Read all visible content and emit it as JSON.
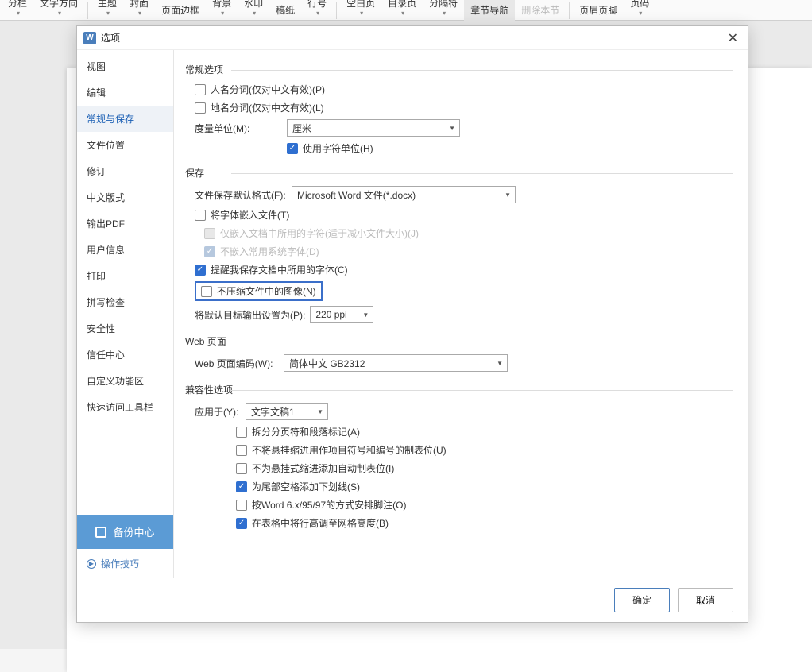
{
  "ribbon": {
    "items": [
      {
        "label": "分栏",
        "dd": true
      },
      {
        "label": "文字方向",
        "dd": true
      },
      {
        "sep": true
      },
      {
        "label": "主题",
        "dd": true
      },
      {
        "label": "封面",
        "dd": true
      },
      {
        "label": "页面边框"
      },
      {
        "label": "背景",
        "dd": true
      },
      {
        "label": "水印",
        "dd": true
      },
      {
        "label": "稿纸"
      },
      {
        "label": "行号",
        "dd": true
      },
      {
        "sep": true
      },
      {
        "label": "空白页",
        "dd": true
      },
      {
        "label": "目录页",
        "dd": true
      },
      {
        "label": "分隔符",
        "dd": true
      },
      {
        "label": "章节导航",
        "active": true
      },
      {
        "label": "删除本节",
        "disabled": true
      },
      {
        "sep": true
      },
      {
        "label": "页眉页脚"
      },
      {
        "label": "页码",
        "dd": true
      }
    ]
  },
  "dialog": {
    "title": "选项",
    "sidebar": [
      "视图",
      "编辑",
      "常规与保存",
      "文件位置",
      "修订",
      "中文版式",
      "输出PDF",
      "用户信息",
      "打印",
      "拼写检查",
      "安全性",
      "信任中心",
      "自定义功能区",
      "快速访问工具栏"
    ],
    "selectedIndex": 2,
    "backup": "备份中心",
    "tips": "操作技巧",
    "groups": {
      "general": {
        "title": "常规选项",
        "personName": "人名分词(仅对中文有效)(P)",
        "placeName": "地名分词(仅对中文有效)(L)",
        "unitLabel": "度量单位(M):",
        "unitValue": "厘米",
        "useCharUnit": "使用字符单位(H)"
      },
      "save": {
        "title": "保存",
        "formatLabel": "文件保存默认格式(F):",
        "formatValue": "Microsoft Word 文件(*.docx)",
        "embedFonts": "将字体嵌入文件(T)",
        "embedOnly": "仅嵌入文档中所用的字符(适于减小文件大小)(J)",
        "noSystem": "不嵌入常用系统字体(D)",
        "remindFonts": "提醒我保存文档中所用的字体(C)",
        "noCompress": "不压缩文件中的图像(N)",
        "defaultOutLabel": "将默认目标输出设置为(P):",
        "defaultOutValue": "220 ppi"
      },
      "web": {
        "title": "Web 页面",
        "encodingLabel": "Web 页面编码(W):",
        "encodingValue": "简体中文 GB2312"
      },
      "compat": {
        "title": "兼容性选项",
        "applyLabel": "应用于(Y):",
        "applyValue": "文字文稿1",
        "splitPage": "拆分分页符和段落标记(A)",
        "noHangBullet": "不将悬挂缩进用作项目符号和编号的制表位(U)",
        "noHangAuto": "不为悬挂式缩进添加自动制表位(I)",
        "trailUnderline": "为尾部空格添加下划线(S)",
        "word6": "按Word 6.x/95/97的方式安排脚注(O)",
        "tableRow": "在表格中将行高调至网格高度(B)"
      }
    },
    "buttons": {
      "ok": "确定",
      "cancel": "取消"
    }
  }
}
